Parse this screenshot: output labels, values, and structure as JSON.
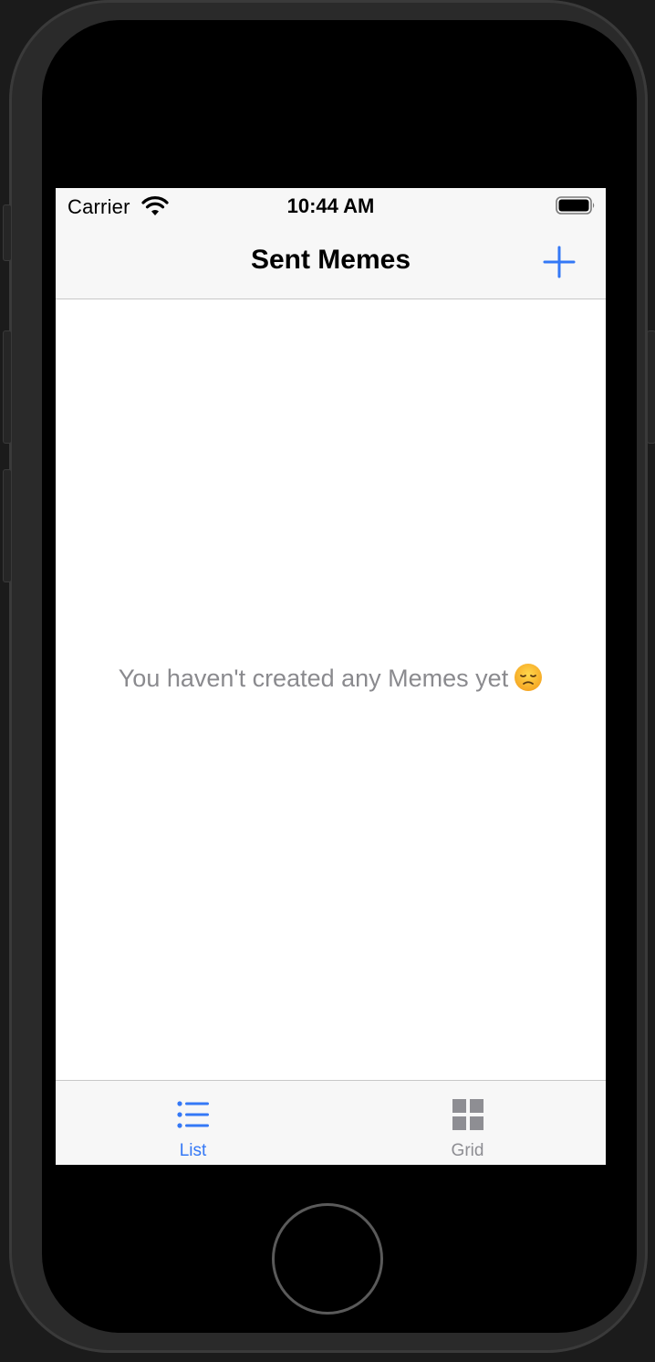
{
  "status_bar": {
    "carrier": "Carrier",
    "time": "10:44 AM",
    "wifi_icon": "wifi-icon",
    "battery_icon": "battery-full-icon"
  },
  "nav_bar": {
    "title": "Sent Memes",
    "add_icon": "plus-icon"
  },
  "content": {
    "empty_message": "You haven't created any Memes yet",
    "emoji_icon": "disappointed-face-emoji"
  },
  "tab_bar": {
    "tabs": [
      {
        "label": "List",
        "icon": "list-icon",
        "selected": true
      },
      {
        "label": "Grid",
        "icon": "grid-icon",
        "selected": false
      }
    ]
  },
  "colors": {
    "accent": "#3478f6",
    "inactive": "#8e8e93",
    "bar_background": "#f7f7f7",
    "empty_text": "#8a8a8e"
  }
}
